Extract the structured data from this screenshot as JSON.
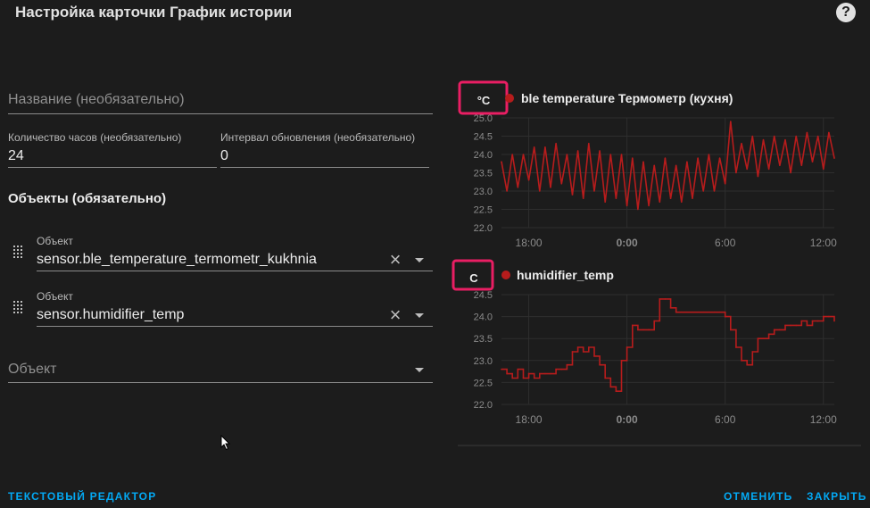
{
  "dialog": {
    "title": "Настройка карточки График истории",
    "help_icon": "question-circle-icon"
  },
  "form": {
    "name_placeholder": "Название (необязательно)",
    "hours_label": "Количество часов (необязательно)",
    "hours_value": "24",
    "refresh_label": "Интервал обновления (необязательно)",
    "refresh_value": "0",
    "entities_heading": "Объекты (обязательно)",
    "entities": [
      {
        "label": "Объект",
        "value": "sensor.ble_temperature_termometr_kukhnia"
      },
      {
        "label": "Объект",
        "value": "sensor.humidifier_temp"
      }
    ],
    "new_entity_placeholder": "Объект"
  },
  "charts": [
    {
      "unit": "°C",
      "legend": "ble temperature Термометр (кухня)",
      "color": "#b71c1c",
      "yticks": [
        "25.0",
        "24.5",
        "24.0",
        "23.5",
        "23.0",
        "22.5",
        "22.0"
      ],
      "xticks": [
        "18:00",
        "0:00",
        "6:00",
        "12:00"
      ]
    },
    {
      "unit": "C",
      "legend": "humidifier_temp",
      "color": "#b71c1c",
      "yticks": [
        "24.5",
        "24.0",
        "23.5",
        "23.0",
        "22.5",
        "22.0"
      ],
      "xticks": [
        "18:00",
        "0:00",
        "6:00",
        "12:00"
      ]
    }
  ],
  "chart_data": [
    {
      "type": "line",
      "title": "",
      "series": [
        {
          "name": "ble temperature Термометр (кухня)",
          "x": [
            "16:20",
            "16:40",
            "17:00",
            "17:20",
            "17:40",
            "18:00",
            "18:20",
            "18:40",
            "19:00",
            "19:20",
            "19:40",
            "20:00",
            "20:20",
            "20:40",
            "21:00",
            "21:20",
            "21:40",
            "22:00",
            "22:20",
            "22:40",
            "23:00",
            "23:20",
            "23:40",
            "0:00",
            "0:20",
            "0:40",
            "1:00",
            "1:20",
            "1:40",
            "2:00",
            "2:20",
            "2:40",
            "3:00",
            "3:20",
            "3:40",
            "4:00",
            "4:20",
            "4:40",
            "5:00",
            "5:20",
            "5:40",
            "6:00",
            "6:20",
            "6:40",
            "7:00",
            "7:20",
            "7:40",
            "8:00",
            "8:20",
            "8:40",
            "9:00",
            "9:20",
            "9:40",
            "10:00",
            "10:20",
            "10:40",
            "11:00",
            "11:20",
            "11:40",
            "12:00",
            "12:20",
            "12:40"
          ],
          "values": [
            23.8,
            23.0,
            24.0,
            23.1,
            24.0,
            23.3,
            24.2,
            23.0,
            24.2,
            23.1,
            24.3,
            23.2,
            24.0,
            22.9,
            24.1,
            22.8,
            24.3,
            23.0,
            24.1,
            22.7,
            24.0,
            22.8,
            24.0,
            22.6,
            23.9,
            22.5,
            23.8,
            22.6,
            23.7,
            22.7,
            23.9,
            22.8,
            23.7,
            22.7,
            23.8,
            22.8,
            23.9,
            23.0,
            24.0,
            23.0,
            23.9,
            23.2,
            24.9,
            23.5,
            24.3,
            23.6,
            24.5,
            23.4,
            24.4,
            23.6,
            24.5,
            23.7,
            24.4,
            23.5,
            24.5,
            23.7,
            24.6,
            23.8,
            24.5,
            23.6,
            24.6,
            23.9
          ]
        }
      ],
      "xlabel": "",
      "ylabel": "°C",
      "ylim": [
        22.0,
        25.0
      ],
      "xticks": [
        "18:00",
        "0:00",
        "6:00",
        "12:00"
      ]
    },
    {
      "type": "line",
      "title": "",
      "series": [
        {
          "name": "humidifier_temp",
          "x": [
            "16:20",
            "16:40",
            "17:00",
            "17:20",
            "17:40",
            "18:00",
            "18:20",
            "18:40",
            "19:00",
            "19:20",
            "19:40",
            "20:00",
            "20:20",
            "20:40",
            "21:00",
            "21:20",
            "21:40",
            "22:00",
            "22:20",
            "22:40",
            "23:00",
            "23:20",
            "23:40",
            "0:00",
            "0:20",
            "0:40",
            "1:00",
            "1:20",
            "1:40",
            "2:00",
            "2:20",
            "2:40",
            "3:00",
            "3:20",
            "3:40",
            "4:00",
            "4:20",
            "4:40",
            "5:00",
            "5:20",
            "5:40",
            "6:00",
            "6:20",
            "6:40",
            "7:00",
            "7:20",
            "7:40",
            "8:00",
            "8:20",
            "8:40",
            "9:00",
            "9:20",
            "9:40",
            "10:00",
            "10:20",
            "10:40",
            "11:00",
            "11:20",
            "11:40",
            "12:00",
            "12:20",
            "12:40"
          ],
          "values": [
            22.8,
            22.7,
            22.6,
            22.8,
            22.6,
            22.7,
            22.6,
            22.7,
            22.7,
            22.7,
            22.8,
            22.8,
            22.9,
            23.2,
            23.3,
            23.2,
            23.3,
            23.1,
            22.9,
            22.6,
            22.4,
            22.3,
            23.0,
            23.3,
            23.8,
            23.7,
            23.7,
            23.7,
            23.9,
            24.4,
            24.4,
            24.2,
            24.1,
            24.1,
            24.1,
            24.1,
            24.1,
            24.1,
            24.1,
            24.1,
            24.1,
            24.0,
            23.7,
            23.3,
            23.0,
            22.9,
            23.2,
            23.5,
            23.5,
            23.6,
            23.7,
            23.7,
            23.8,
            23.8,
            23.8,
            23.9,
            23.8,
            23.9,
            23.9,
            24.0,
            24.0,
            23.9
          ]
        }
      ],
      "xlabel": "",
      "ylabel": "C",
      "ylim": [
        22.0,
        24.5
      ],
      "xticks": [
        "18:00",
        "0:00",
        "6:00",
        "12:00"
      ]
    }
  ],
  "footer": {
    "text_editor": "ТЕКСТОВЫЙ РЕДАКТОР",
    "cancel": "ОТМЕНИТЬ",
    "close": "ЗАКРЫТЬ"
  }
}
